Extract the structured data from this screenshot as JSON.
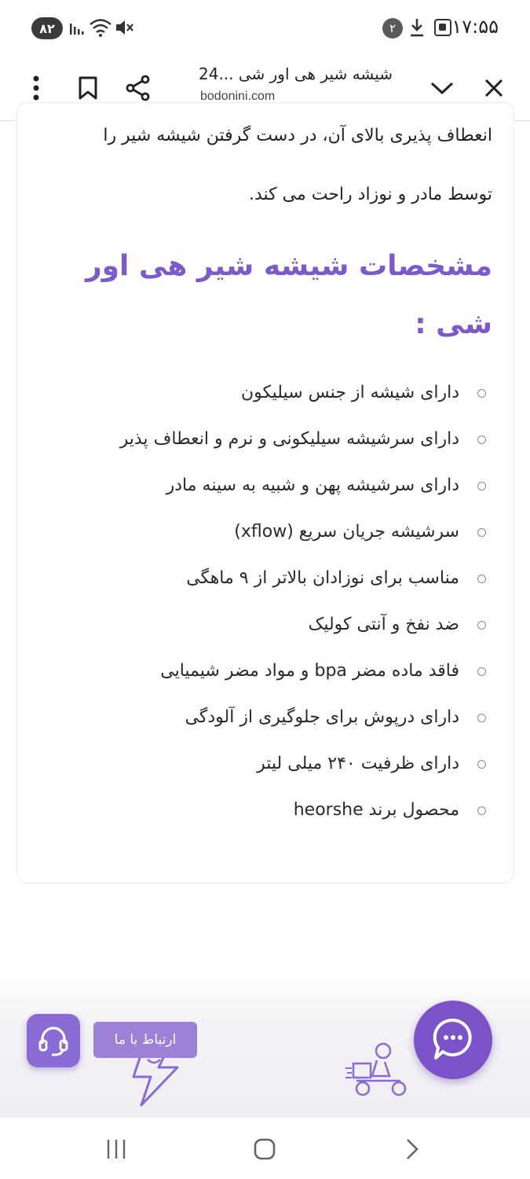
{
  "status_bar": {
    "time": "۱۷:۵۵",
    "notification_count": "۲",
    "battery_level": "۸۲",
    "icons": [
      "screenshot-icon",
      "download-icon",
      "battery-icon",
      "signal-icon",
      "wifi-icon",
      "mute-icon"
    ]
  },
  "browser": {
    "page_title": "شیشه شیر هی اور شی ...24",
    "url": "bodonini.com",
    "icons": [
      "close-icon",
      "chevron-down-icon",
      "share-icon",
      "bookmark-icon",
      "more-vertical-icon"
    ]
  },
  "article": {
    "paragraph_line1": "انعطاف پذیری بالای آن، در دست گرفتن شیشه شیر را",
    "paragraph_line2": "توسط مادر و نوزاد راحت می کند.",
    "heading_line1": "مشخصات شیشه شیر هی اور",
    "heading_line2": "شی :",
    "features": [
      "دارای شیشه از جنس سیلیکون",
      "دارای سرشیشه سیلیکونی و نرم و انعطاف پذیر",
      "دارای سرشیشه پهن و شبیه به سینه مادر",
      "سرشیشه جریان سریع (xflow)",
      "مناسب برای نوزادان بالاتر از ۹ ماهگی",
      "ضد نفخ و آنتی کولیک",
      "فاقد ماده مضر bpa و مواد مضر شیمیایی",
      "دارای درپوش برای جلوگیری از آلودگی",
      "دارای ظرفیت ۲۴۰ میلی لیتر",
      "محصول برند heorshe"
    ]
  },
  "footer": {
    "contact_label": "ارتباط با ما",
    "icons": [
      "headset-icon",
      "chat-icon",
      "lightning-icon",
      "delivery-courier-icon"
    ]
  },
  "colors": {
    "accent": "#7c5ac9",
    "chat_button": "#7b52c8",
    "contact_label_bg": "#9b82d6",
    "support_button": "#8a6ad3"
  },
  "nav_bar": {
    "icons": [
      "recents-icon",
      "home-icon",
      "back-icon"
    ]
  }
}
